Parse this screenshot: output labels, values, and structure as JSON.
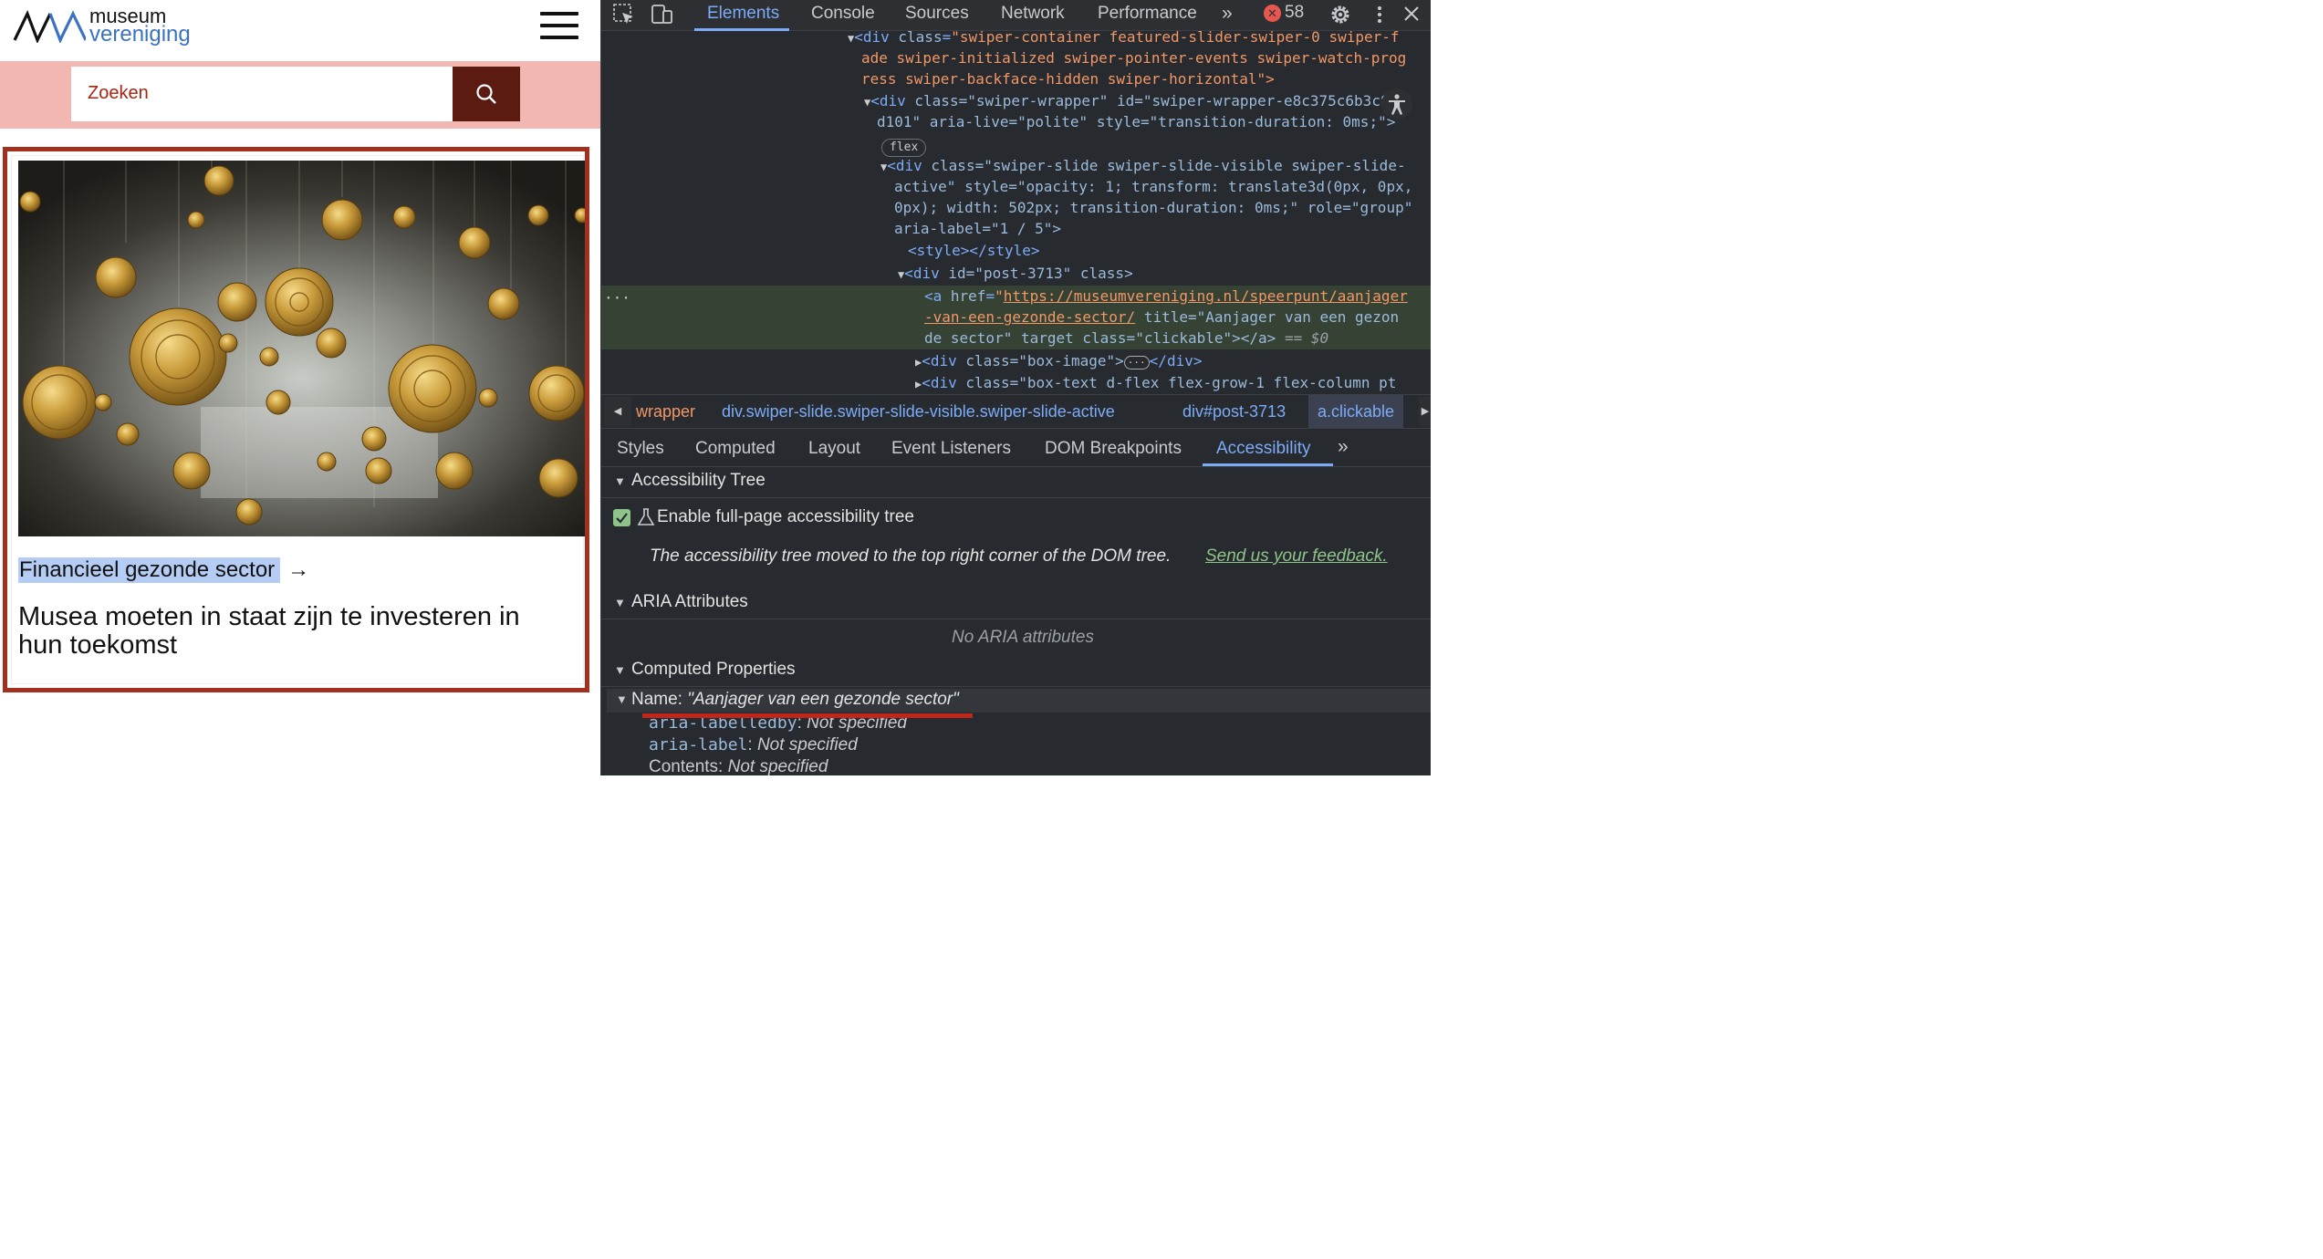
{
  "site": {
    "logo": {
      "word1": "museum",
      "word2": "vereniging"
    },
    "search": {
      "placeholder": "Zoeken"
    },
    "card": {
      "tag": "Financieel gezonde sector",
      "arrow": "→",
      "title": "Musea moeten in staat zijn te investeren in hun toekomst"
    },
    "colors": {
      "brand_red": "#a3301f",
      "search_band": "#f3b7b1",
      "search_button": "#5c1b10",
      "logo_blue": "#3a73c4"
    }
  },
  "devtools": {
    "tabs": [
      "Elements",
      "Console",
      "Sources",
      "Network",
      "Performance"
    ],
    "more_tabs_icon": "chevron-double-right-icon",
    "error_count": "58",
    "dom": {
      "l1": {
        "attr": "class",
        "val1": "swiper-container featured-slider-swiper-0 swiper-f"
      },
      "l2": {
        "text": "ade swiper-initialized swiper-pointer-events swiper-watch-prog"
      },
      "l3": {
        "text": "ress swiper-backface-hidden swiper-horizontal\">"
      },
      "l4": {
        "text": "class=\"swiper-wrapper\" id=\"swiper-wrapper-e8c375c6b3c8e"
      },
      "l5": {
        "text": "d101\" aria-live=\"polite\" style=\"transition-duration: 0ms;\">"
      },
      "flex_pill": "flex",
      "l6": {
        "text": "class=\"swiper-slide swiper-slide-visible swiper-slide-"
      },
      "l7": {
        "text": "active\" style=\"opacity: 1; transform: translate3d(0px, 0px,"
      },
      "l8": {
        "text": "0px); width: 502px; transition-duration: 0ms;\" role=\"group\""
      },
      "l9": {
        "text": "aria-label=\"1 / 5\">"
      },
      "l10": {
        "text": "<style></style>"
      },
      "l11": {
        "text": "id=\"post-3713\" class>"
      },
      "l12": {
        "href1": "https://museumvereniging.nl/speerpunt/aanjager"
      },
      "l13": {
        "href2": "-van-een-gezonde-sector/",
        "rest": " title=\"Aanjager van een gezon"
      },
      "l14": {
        "text": "de sector\" target class=\"clickable\"></a>",
        "eq": " == $0"
      },
      "l15": {
        "text": "class=\"box-image\">",
        "end": "</div>"
      },
      "l16": {
        "text": "class=\"box-text d-flex flex-grow-1 flex-column pt"
      }
    },
    "breadcrumbs": [
      "wrapper",
      "div.swiper-slide.swiper-slide-visible.swiper-slide-active",
      "div#post-3713",
      "a.clickable"
    ],
    "subtabs": [
      "Styles",
      "Computed",
      "Layout",
      "Event Listeners",
      "DOM Breakpoints",
      "Accessibility"
    ],
    "accessibility": {
      "tree_header": "Accessibility Tree",
      "enable_label": "Enable full-page accessibility tree",
      "moved_message": "The accessibility tree moved to the top right corner of the DOM tree.",
      "feedback_link": "Send us your feedback.",
      "aria_header": "ARIA Attributes",
      "no_aria": "No ARIA attributes",
      "computed_header": "Computed Properties",
      "name_label": "Name: ",
      "name_value": "\"Aanjager van een gezonde sector\"",
      "props": [
        {
          "key": "aria-labelledby",
          "value": "Not specified"
        },
        {
          "key": "aria-label",
          "value": "Not specified"
        },
        {
          "key": "Contents",
          "value": "Not specified"
        }
      ]
    },
    "colors": {
      "bg": "#272a2e",
      "accent": "#7cacf8",
      "tag": "#7cacf8",
      "attr": "#9bbbdc",
      "value": "#f29766",
      "selected_row": "#364234",
      "highlight_red": "#c0271a"
    }
  }
}
